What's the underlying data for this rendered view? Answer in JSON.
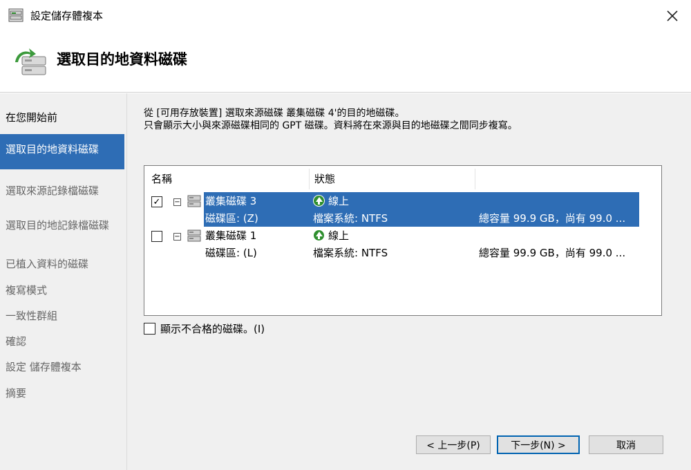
{
  "window": {
    "title": "設定儲存體複本"
  },
  "header": {
    "title": "選取目的地資料磁碟"
  },
  "sidebar": {
    "items": [
      {
        "label": "在您開始前"
      },
      {
        "label": "選取目的地資料磁碟"
      },
      {
        "label": "選取來源記錄檔磁碟"
      },
      {
        "label": "選取目的地記錄檔磁碟"
      },
      {
        "label": "已植入資料的磁碟"
      },
      {
        "label": "複寫模式"
      },
      {
        "label": "一致性群組"
      },
      {
        "label": "確認"
      },
      {
        "label": "設定 儲存體複本"
      },
      {
        "label": "摘要"
      }
    ]
  },
  "main": {
    "description_line1": "從 [可用存放裝置] 選取來源磁碟 叢集磁碟 4'的目的地磁碟。",
    "description_line2": "只會顯示大小與來源磁碟相同的 GPT 磁碟。資料將在來源與目的地磁碟之間同步複寫。",
    "columns": {
      "name": "名稱",
      "status": "狀態"
    },
    "disks": [
      {
        "checked": true,
        "name": "叢集磁碟 3",
        "volume": "磁碟區: (Z)",
        "status": "線上",
        "filesystem": "檔案系統: NTFS",
        "capacity": "總容量 99.9 GB，尚有 99.0 ..."
      },
      {
        "checked": false,
        "name": "叢集磁碟 1",
        "volume": "磁碟區: (L)",
        "status": "線上",
        "filesystem": "檔案系統: NTFS",
        "capacity": "總容量 99.9 GB，尚有 99.0 ..."
      }
    ],
    "show_ineligible_label": "顯示不合格的磁碟。(I)"
  },
  "buttons": {
    "previous": "< 上一步(P)",
    "next": "下一步(N) >",
    "cancel": "取消"
  },
  "colors": {
    "accent": "#2e6db5",
    "panel": "#f0f0f0",
    "status_ok": "#2f8f2f"
  },
  "icons": {
    "app": "storage-replica-icon",
    "status": "online-arrow-icon",
    "disk": "disk-icon"
  }
}
